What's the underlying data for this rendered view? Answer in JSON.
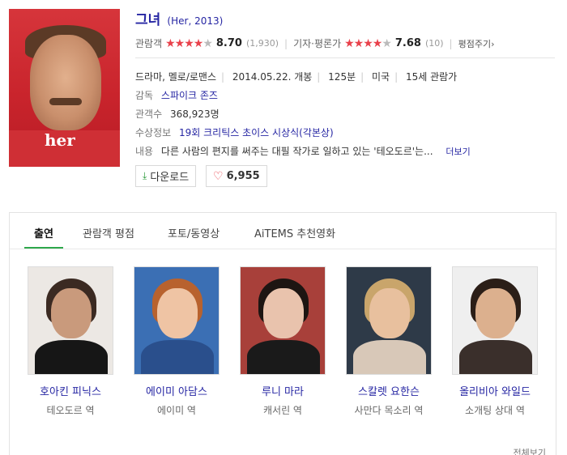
{
  "movie": {
    "title": "그녀",
    "title_sub": "(Her, 2013)",
    "audience_label": "관람객",
    "audience_score": "8.70",
    "audience_count": "(1,930)",
    "critic_label": "기자·평론가",
    "critic_score": "7.68",
    "critic_count": "(10)",
    "rate_link": "평점주기›",
    "genre": "드라마, 멜로/로맨스",
    "release": "2014.05.22. 개봉",
    "runtime": "125분",
    "country": "미국",
    "age_rating": "15세 관람가",
    "director_label": "감독",
    "director": "스파이크 존즈",
    "viewers_label": "관객수",
    "viewers": "368,923명",
    "award_label": "수상정보",
    "award": "19회 크리틱스 초이스 시상식(각본상)",
    "synopsis_label": "내용",
    "synopsis": "다른 사람의 편지를 써주는 대필 작가로 일하고 있는 '테오도르'는...",
    "more_link": "더보기",
    "download_label": "다운로드",
    "like_count": "6,955",
    "poster_logo": "her"
  },
  "tabs": [
    {
      "label": "출연"
    },
    {
      "label": "관람객 평점"
    },
    {
      "label": "포토/동영상"
    },
    {
      "label": "AiTEMS 추천영화"
    }
  ],
  "cast": [
    {
      "name": "호아킨 피닉스",
      "role": "테오도르 역"
    },
    {
      "name": "에이미 아담스",
      "role": "에이미 역"
    },
    {
      "name": "루니 마라",
      "role": "캐서린 역"
    },
    {
      "name": "스칼렛 요한슨",
      "role": "사만다 목소리 역"
    },
    {
      "name": "올리비아 와일드",
      "role": "소개팅 상대 역"
    }
  ],
  "all_view": "전체보기",
  "colors": {
    "link": "#2626a3",
    "star": "#e9414b",
    "tab_active_underline": "#2ea84b",
    "poster_red": "#c9242c"
  }
}
